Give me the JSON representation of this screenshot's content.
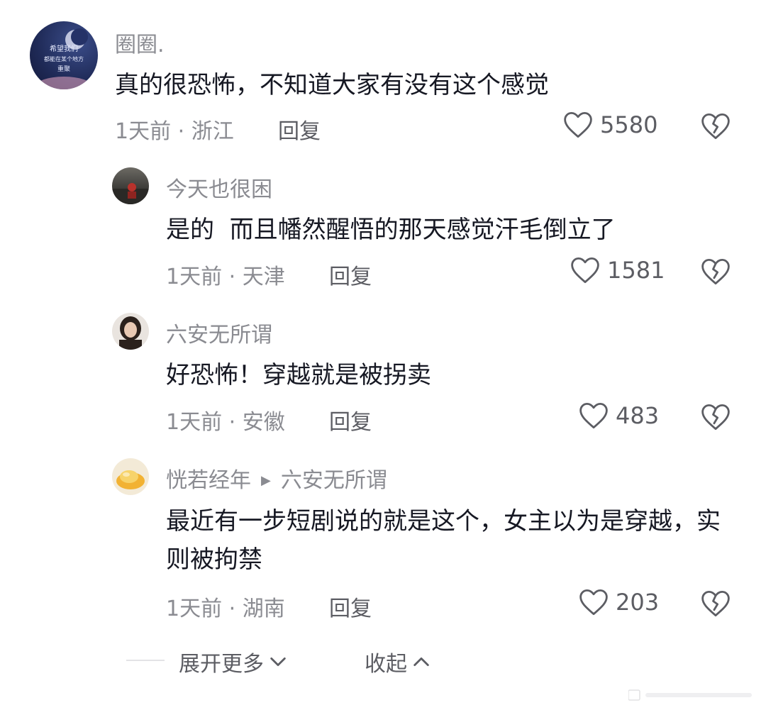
{
  "comments": [
    {
      "username": "圈圈.",
      "content": "真的很恐怖，不知道大家有没有这个感觉",
      "meta": "1天前 · 浙江",
      "reply_label": "回复",
      "likes": "5580",
      "avatar_text_line1": "希望我们",
      "avatar_text_line2": "都能在某个地方",
      "avatar_text_line3": "重聚"
    },
    {
      "username": "今天也很困",
      "content": "是的  而且幡然醒悟的那天感觉汗毛倒立了",
      "meta": "1天前 · 天津",
      "reply_label": "回复",
      "likes": "1581"
    },
    {
      "username": "六安无所谓",
      "content": "好恐怖！穿越就是被拐卖",
      "meta": "1天前 · 安徽",
      "reply_label": "回复",
      "likes": "483"
    },
    {
      "username": "恍若经年",
      "reply_to": "六安无所谓",
      "content": "最近有一步短剧说的就是这个，女主以为是穿越，实则被拘禁",
      "meta": "1天前 · 湖南",
      "reply_label": "回复",
      "likes": "203"
    }
  ],
  "footer": {
    "expand_label": "展开更多",
    "collapse_label": "收起"
  },
  "icons": {
    "like": "heart-outline-icon",
    "dislike": "broken-heart-icon",
    "expand": "chevron-down-icon",
    "collapse": "chevron-up-icon",
    "reply_arrow": "triangle-right-icon"
  },
  "colors": {
    "text_primary": "#161823",
    "text_secondary": "#8a8b91",
    "text_action": "#5c5d63",
    "background": "#ffffff"
  }
}
